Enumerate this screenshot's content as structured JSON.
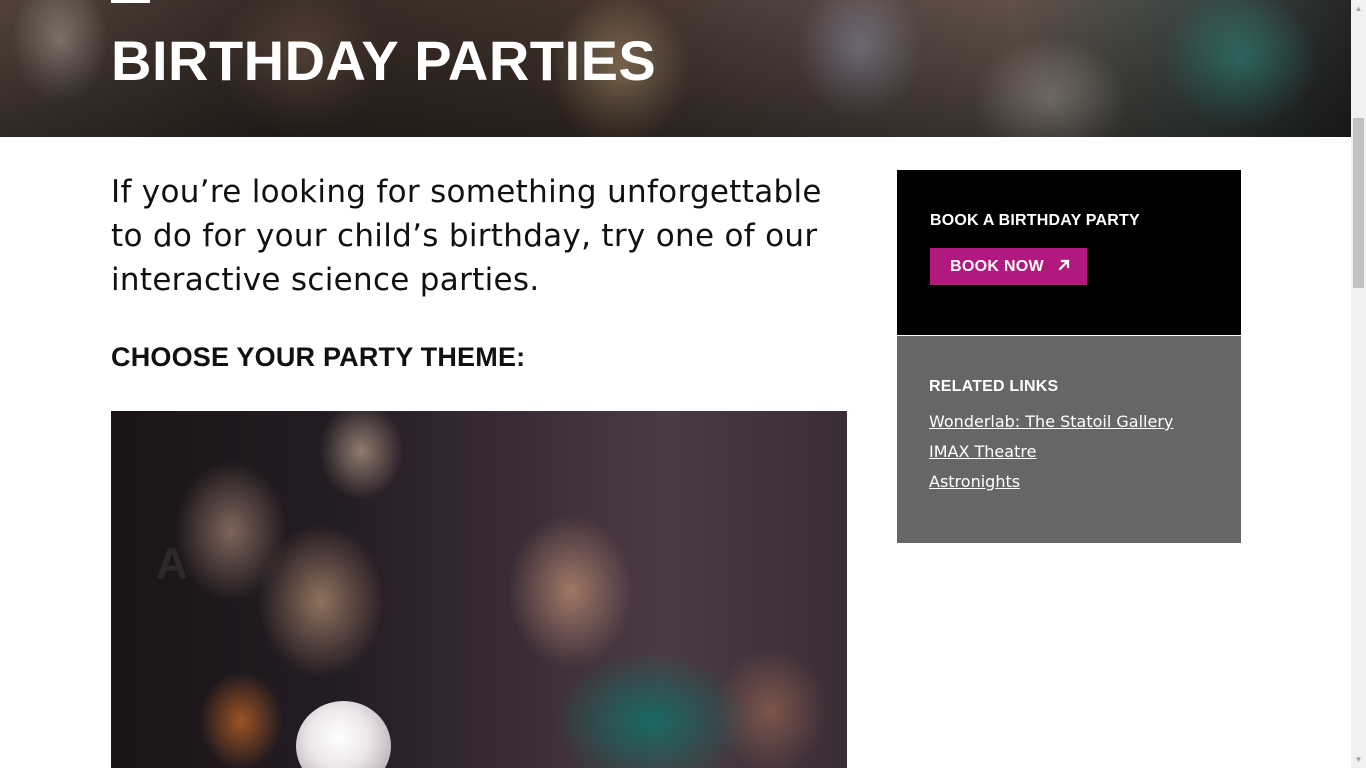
{
  "hero": {
    "title": "BIRTHDAY PARTIES"
  },
  "intro": {
    "text": "If you’re looking for something unforgettable to do for your child’s birthday, try one of our interactive science parties."
  },
  "themes": {
    "heading": "CHOOSE YOUR PARTY THEME:"
  },
  "sidebar": {
    "book": {
      "title": "BOOK A BIRTHDAY PARTY",
      "button_label": "BOOK NOW",
      "button_icon": "arrow-up-right-icon",
      "button_color": "#b1197f"
    },
    "related": {
      "title": "RELATED LINKS",
      "links": [
        "Wonderlab: The Statoil Gallery",
        "IMAX Theatre",
        "Astronights"
      ]
    }
  },
  "colors": {
    "book_box_bg": "#000000",
    "related_box_bg": "#666666",
    "accent": "#b1197f"
  }
}
